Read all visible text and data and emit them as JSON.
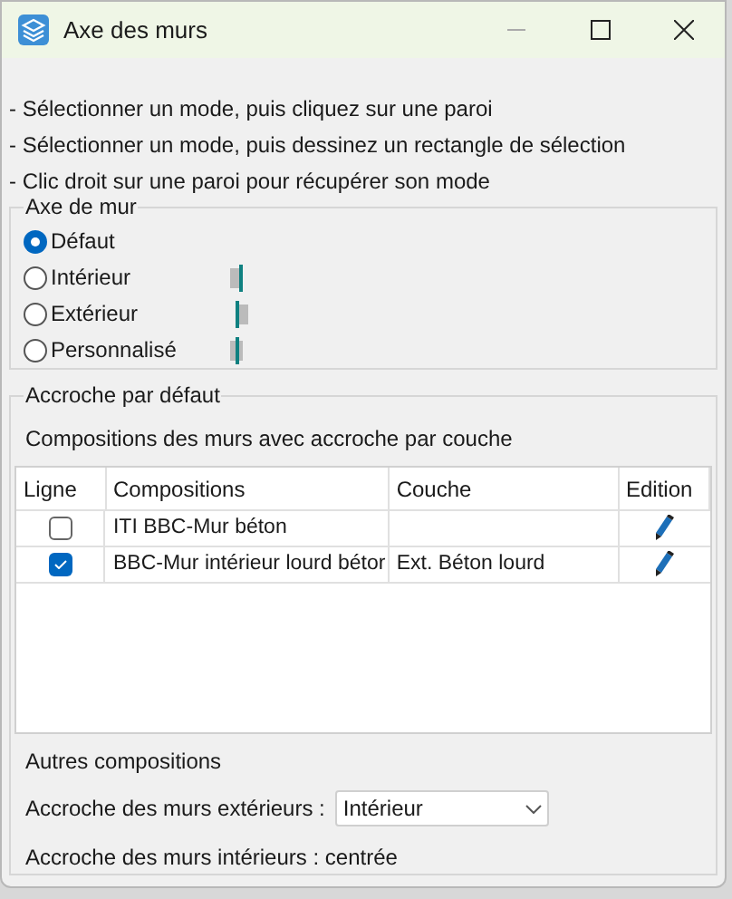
{
  "window": {
    "title": "Axe des murs"
  },
  "instructions": [
    "- Sélectionner un mode, puis cliquez sur une paroi",
    "- Sélectionner un mode, puis dessinez un rectangle de sélection",
    "- Clic droit sur une paroi pour récupérer son mode"
  ],
  "wall_axis": {
    "title": "Axe de mur",
    "options": [
      {
        "label": "Défaut",
        "selected": true,
        "kind": "none"
      },
      {
        "label": "Intérieur",
        "selected": false,
        "kind": "interior"
      },
      {
        "label": "Extérieur",
        "selected": false,
        "kind": "exterior"
      },
      {
        "label": "Personnalisé",
        "selected": false,
        "kind": "custom"
      }
    ]
  },
  "default_snap": {
    "title": "Accroche par défaut",
    "subtitle": "Compositions des murs avec accroche par couche",
    "table": {
      "columns": [
        "Ligne",
        "Compositions",
        "Couche",
        "Edition"
      ],
      "rows": [
        {
          "checked": false,
          "composition": "ITI BBC-Mur béton"
        },
        {
          "checked": true,
          "composition": "BBC-Mur intérieur lourd bétor",
          "layer": "Ext. Béton lourd"
        }
      ]
    },
    "other_title": "Autres compositions",
    "exterior_label": "Accroche des murs extérieurs :",
    "exterior_value": "Intérieur",
    "interior_text": "Accroche des murs intérieurs : centrée"
  }
}
